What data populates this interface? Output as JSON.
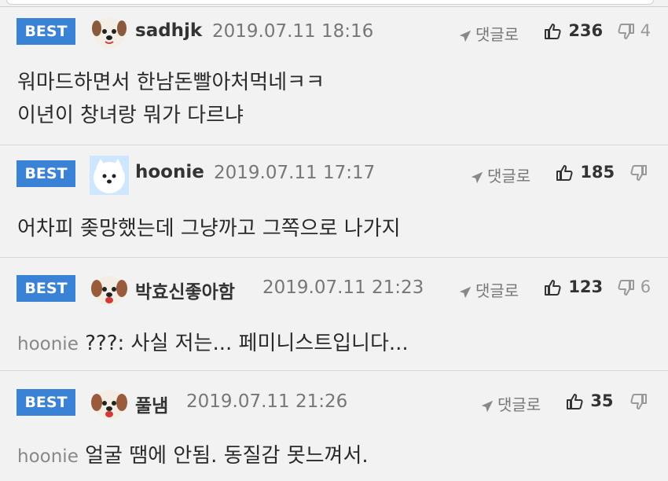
{
  "comments": [
    {
      "badge": "BEST",
      "user": "sadhjk",
      "date": "2019.07.11 18:16",
      "reply_label": "댓글로",
      "likes": "236",
      "dislikes": "4",
      "mention": "",
      "lines": [
        "워마드하면서 한남돈빨아처먹네ㅋㅋ",
        "이년이 창녀랑 뭐가 다르냐"
      ]
    },
    {
      "badge": "BEST",
      "user": "hoonie",
      "date": "2019.07.11 17:17",
      "reply_label": "댓글로",
      "likes": "185",
      "dislikes": "",
      "mention": "",
      "lines": [
        "어차피 좆망했는데 그냥까고 그쪽으로 나가지"
      ]
    },
    {
      "badge": "BEST",
      "user": "박효신좋아함",
      "date": "2019.07.11 21:23",
      "reply_label": "댓글로",
      "likes": "123",
      "dislikes": "6",
      "mention": "hoonie",
      "lines": [
        "???: 사실 저는... 페미니스트입니다..."
      ]
    },
    {
      "badge": "BEST",
      "user": "풀냄",
      "date": "2019.07.11 21:26",
      "reply_label": "댓글로",
      "likes": "35",
      "dislikes": "",
      "mention": "hoonie",
      "lines": [
        "얼굴 땜에 안됨. 동질감 못느껴서."
      ]
    }
  ],
  "icons": {
    "reply": "reply-arrow-icon",
    "like": "thumbs-up-icon",
    "dislike": "thumbs-down-icon"
  },
  "colors": {
    "badge": "#3a82d6",
    "background": "#f2f2f2"
  }
}
